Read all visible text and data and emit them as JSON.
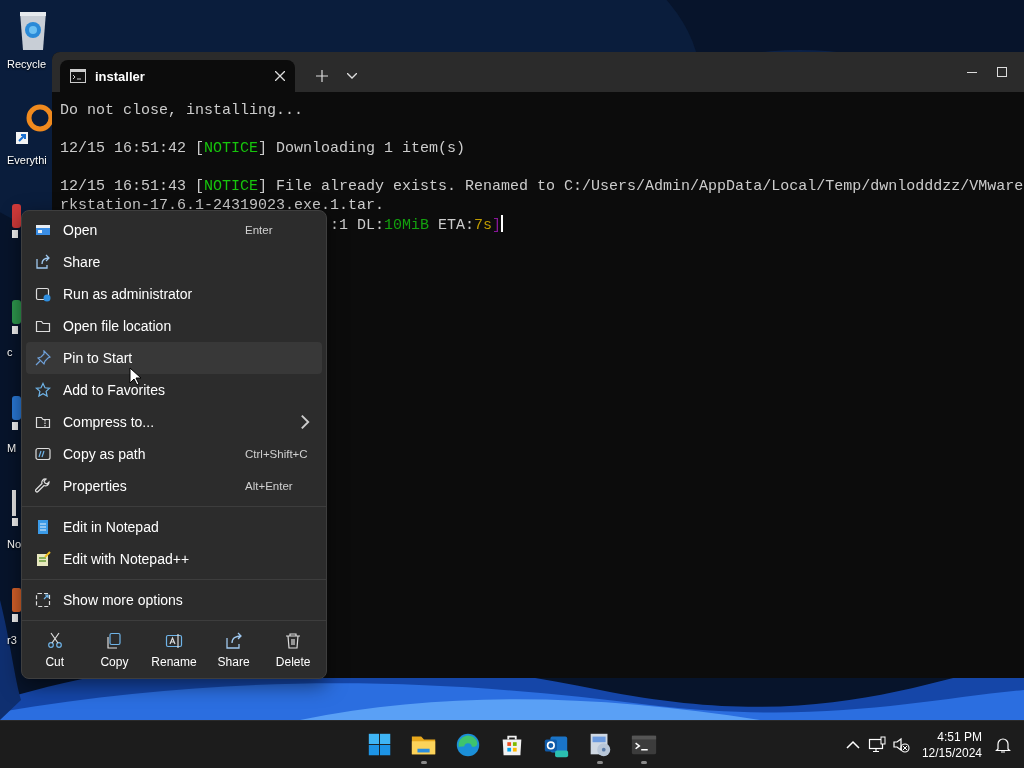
{
  "desktop_icons": [
    {
      "kind": "labeled",
      "label": "Recycle"
    },
    {
      "kind": "labeled",
      "label": "Everythi"
    },
    {
      "kind": "covered"
    },
    {
      "kind": "labeled",
      "label": "c"
    },
    {
      "kind": "labeled",
      "label": "M"
    },
    {
      "kind": "labeled",
      "label": "No"
    },
    {
      "kind": "labeled",
      "label": "r3"
    }
  ],
  "terminal": {
    "tab": {
      "title": "installer",
      "selected": true
    },
    "paragraphs": [
      [
        {
          "segments": [
            {
              "text": "Do not close, installing...",
              "color": "#cccccc"
            }
          ]
        }
      ],
      [
        {
          "segments": [
            {
              "text": "12/15 16:51:42 [",
              "color": "#cccccc"
            },
            {
              "text": "NOTICE",
              "color": "#16c60c"
            },
            {
              "text": "] Downloading 1 item(s)",
              "color": "#cccccc"
            }
          ]
        }
      ],
      [
        {
          "segments": [
            {
              "text": "12/15 16:51:43 [",
              "color": "#cccccc"
            },
            {
              "text": "NOTICE",
              "color": "#16c60c"
            },
            {
              "text": "] File already exists. Renamed to C:/Users/Admin/AppData/Local/Temp/dwnlodddzz/VMware",
              "color": "#cccccc"
            }
          ]
        },
        {
          "segments": [
            {
              "text": "rkstation-17.6.1-24319023.exe.1.tar.",
              "color": "#cccccc"
            }
          ]
        }
      ]
    ],
    "progress_line": {
      "segments": [
        {
          "text": ":1 DL:",
          "color": "#cccccc"
        },
        {
          "text": "10MiB",
          "color": "#13a10e"
        },
        {
          "text": " ETA:",
          "color": "#cccccc"
        },
        {
          "text": "7s",
          "color": "#c19c00"
        },
        {
          "text": "]",
          "color": "#881798"
        }
      ]
    }
  },
  "context_menu": {
    "sections": [
      [
        {
          "label": "Open",
          "shortcut": "Enter",
          "highlighted": false,
          "submenu": false
        },
        {
          "label": "Share",
          "highlighted": false,
          "submenu": false
        },
        {
          "label": "Run as administrator",
          "highlighted": false,
          "submenu": false
        },
        {
          "label": "Open file location",
          "highlighted": false,
          "submenu": false
        },
        {
          "label": "Pin to Start",
          "highlighted": true,
          "submenu": false
        },
        {
          "label": "Add to Favorites",
          "highlighted": false,
          "submenu": false
        },
        {
          "label": "Compress to...",
          "highlighted": false,
          "submenu": true
        },
        {
          "label": "Copy as path",
          "shortcut": "Ctrl+Shift+C",
          "highlighted": false,
          "submenu": false
        },
        {
          "label": "Properties",
          "shortcut": "Alt+Enter",
          "highlighted": false,
          "submenu": false
        }
      ],
      [
        {
          "label": "Edit in Notepad",
          "highlighted": false,
          "submenu": false
        },
        {
          "label": "Edit with Notepad++",
          "highlighted": false,
          "submenu": false
        }
      ],
      [
        {
          "label": "Show more options",
          "highlighted": false,
          "submenu": false
        }
      ]
    ],
    "actions": [
      {
        "label": "Cut"
      },
      {
        "label": "Copy"
      },
      {
        "label": "Rename"
      },
      {
        "label": "Share"
      },
      {
        "label": "Delete"
      }
    ]
  },
  "taskbar": {
    "apps": [
      {
        "running": false
      },
      {
        "running": true
      },
      {
        "running": false
      },
      {
        "running": false
      },
      {
        "running": false
      },
      {
        "running": true
      },
      {
        "running": true
      }
    ],
    "time": "4:51 PM",
    "date": "12/15/2024"
  }
}
